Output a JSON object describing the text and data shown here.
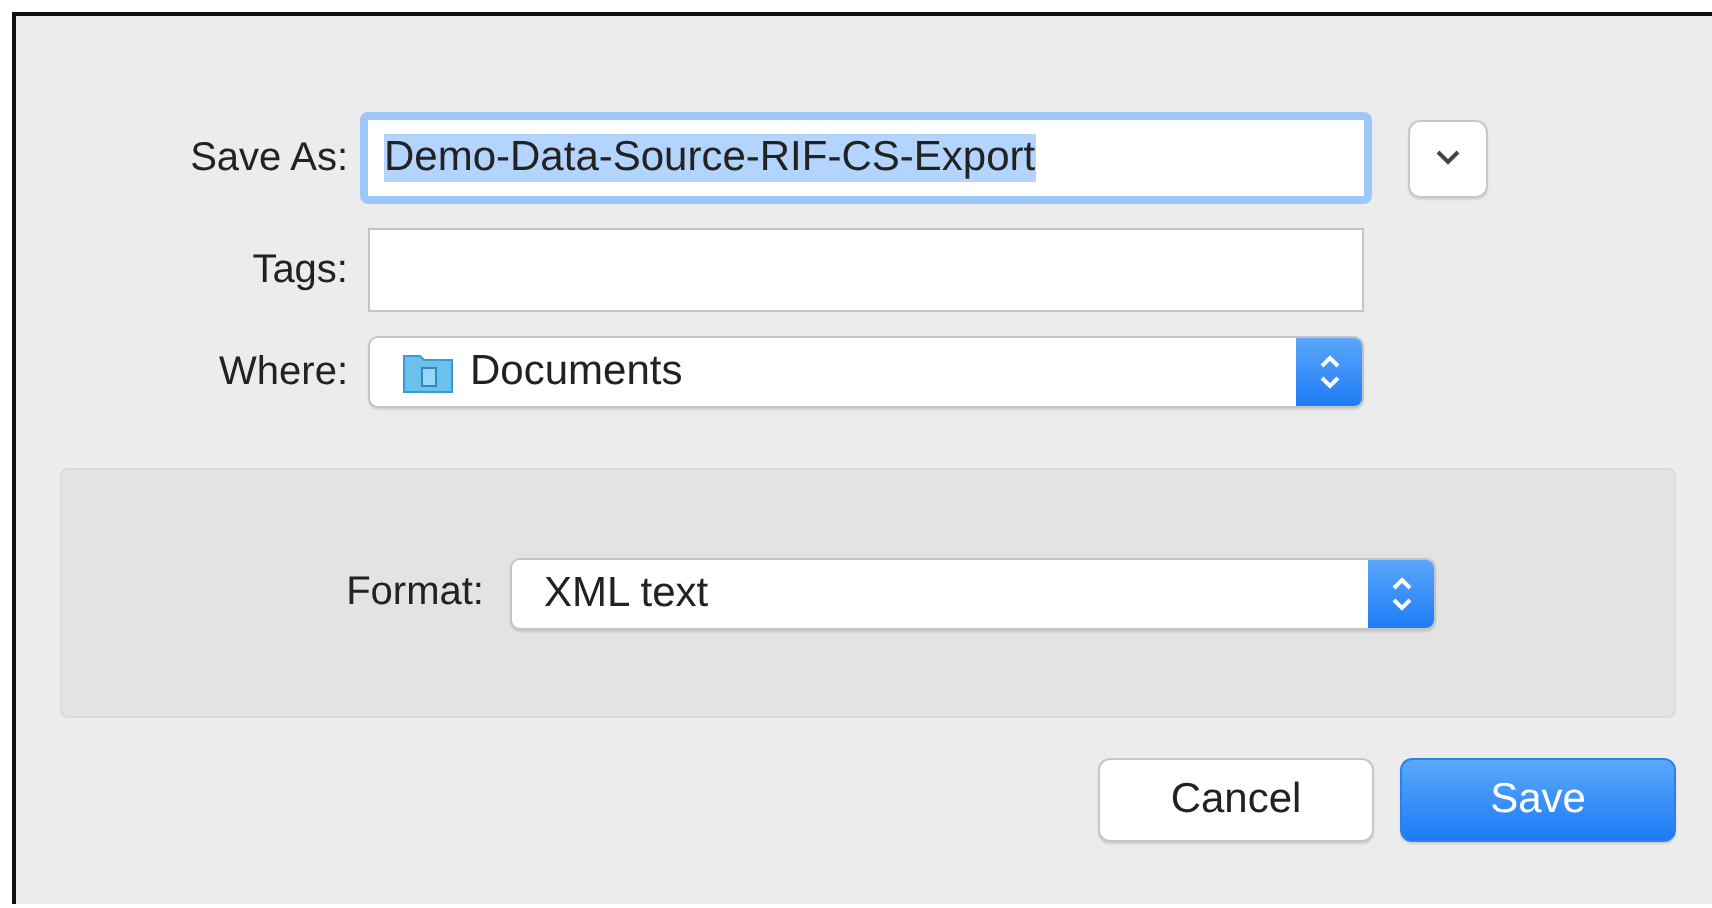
{
  "save_as": {
    "label": "Save As:",
    "value": "Demo-Data-Source-RIF-CS-Export",
    "text_selected": true,
    "focused": true
  },
  "tags": {
    "label": "Tags:"
  },
  "where": {
    "label": "Where:",
    "value": "Documents"
  },
  "format": {
    "label": "Format:",
    "value": "XML text"
  },
  "buttons": [
    {
      "label": "Cancel",
      "default": false
    },
    {
      "label": "Save",
      "default": true
    }
  ]
}
